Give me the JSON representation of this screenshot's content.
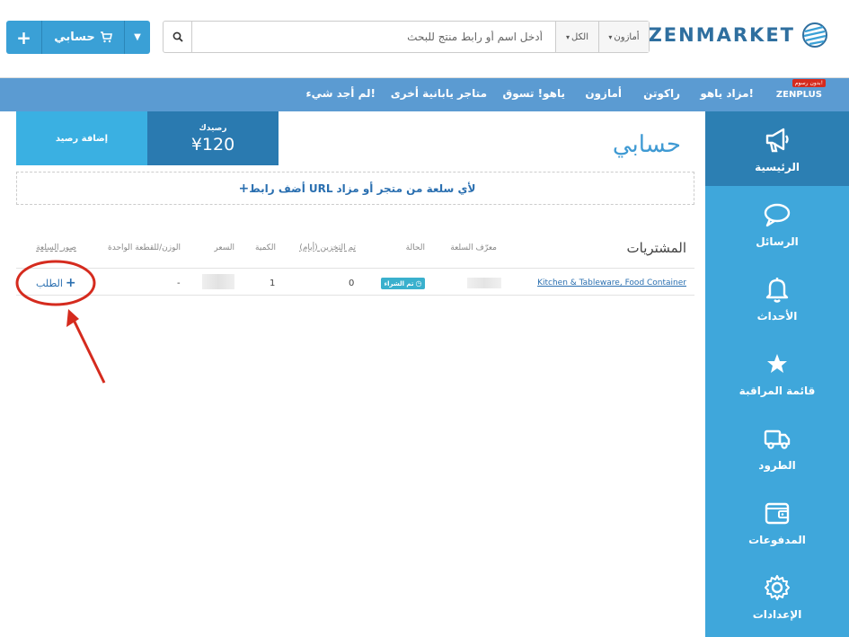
{
  "header": {
    "logo_text": "ZENMARKET",
    "search": {
      "placeholder": "أدخل اسم أو رابط منتج للبحث",
      "category": "الكل",
      "store": "أمازون"
    },
    "account_label": "حسابي"
  },
  "nav": {
    "zenplus": "ZENPLUS",
    "zenplus_badge": "بدون رسوم!",
    "items": [
      "مزاد ياهو!",
      "راكوتن",
      "أمازون",
      "ياهو! تسوق",
      "متاجر يابانية أخرى",
      "لم أجد شيء!"
    ]
  },
  "sidebar": {
    "items": [
      {
        "label": "الرئيسية",
        "icon": "megaphone-icon"
      },
      {
        "label": "الرسائل",
        "icon": "chat-bubble-icon"
      },
      {
        "label": "الأحداث",
        "icon": "bell-icon"
      },
      {
        "label": "قائمة المراقبة",
        "icon": "star-icon"
      },
      {
        "label": "الطرود",
        "icon": "truck-icon"
      },
      {
        "label": "المدفوعات",
        "icon": "wallet-icon"
      },
      {
        "label": "الإعدادات",
        "icon": "gear-icon"
      }
    ]
  },
  "main": {
    "title": "حسابي",
    "balance_label": "رصيدك",
    "balance_value": "¥120",
    "add_balance": "إضافة رصيد",
    "add_url": {
      "pre": "أضف رابط",
      "url": "URL",
      "post": "لأي سلعة من متجر أو مزاد"
    },
    "purchases_title": "المشتريات",
    "columns": [
      "معرّف السلعة",
      "الحالة",
      "تم التخزين (أيام)",
      "الكمية",
      "السعر",
      "الوزن/للقطعة الواحدة",
      "صور السلعة"
    ],
    "rows": [
      {
        "product": "Kitchen & Tableware, Food Container",
        "status": "تم الشراء",
        "days": "0",
        "qty": "1",
        "weight": "-",
        "action": "الطلب"
      }
    ]
  },
  "colors": {
    "primary": "#3aa0d6",
    "nav": "#5b9bd2",
    "sidebar": "#3fa7db",
    "sidebar_active": "#2c7fb3",
    "annotation": "#d52b1e"
  }
}
